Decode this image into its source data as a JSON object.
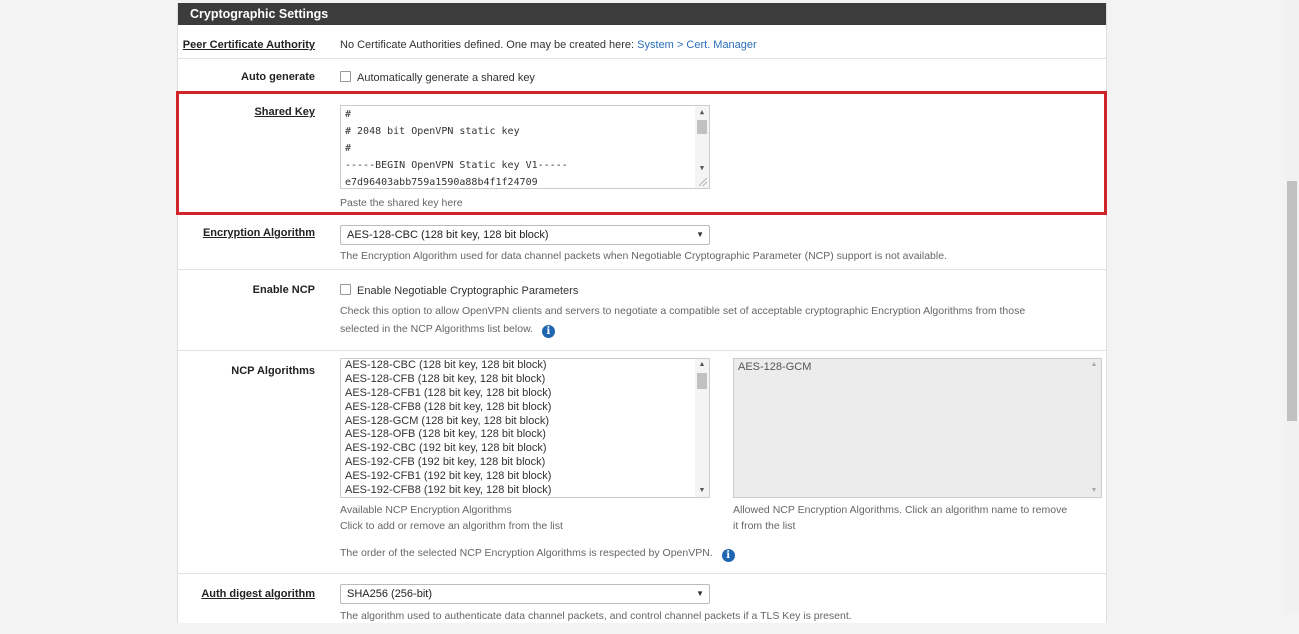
{
  "section": {
    "title": "Cryptographic Settings"
  },
  "peer_ca": {
    "label": "Peer Certificate Authority",
    "text": "No Certificate Authorities defined. One may be created here: ",
    "link": "System > Cert. Manager"
  },
  "auto_generate": {
    "label": "Auto generate",
    "checkbox_label": "Automatically generate a shared key",
    "checked": false
  },
  "shared_key": {
    "label": "Shared Key",
    "lines": [
      "#",
      "# 2048 bit OpenVPN static key",
      "#",
      "-----BEGIN OpenVPN Static key V1-----",
      "e7d96403abb759a1590a88b4f1f24709"
    ],
    "help": "Paste the shared key here"
  },
  "encryption": {
    "label": "Encryption Algorithm",
    "selected": "AES-128-CBC (128 bit key, 128 bit block)",
    "help": "The Encryption Algorithm used for data channel packets when Negotiable Cryptographic Parameter (NCP) support is not available."
  },
  "ncp": {
    "label": "Enable NCP",
    "checkbox_label": "Enable Negotiable Cryptographic Parameters",
    "checked": false,
    "help_line1": "Check this option to allow OpenVPN clients and servers to negotiate a compatible set of acceptable cryptographic Encryption Algorithms from those",
    "help_line2": "selected in the NCP Algorithms list below."
  },
  "ncp_algorithms": {
    "label": "NCP Algorithms",
    "available": [
      "AES-128-CBC (128 bit key, 128 bit block)",
      "AES-128-CFB (128 bit key, 128 bit block)",
      "AES-128-CFB1 (128 bit key, 128 bit block)",
      "AES-128-CFB8 (128 bit key, 128 bit block)",
      "AES-128-GCM (128 bit key, 128 bit block)",
      "AES-128-OFB (128 bit key, 128 bit block)",
      "AES-192-CBC (192 bit key, 128 bit block)",
      "AES-192-CFB (192 bit key, 128 bit block)",
      "AES-192-CFB1 (192 bit key, 128 bit block)",
      "AES-192-CFB8 (192 bit key, 128 bit block)"
    ],
    "allowed": [
      "AES-128-GCM"
    ],
    "available_help_1": "Available NCP Encryption Algorithms",
    "available_help_2": "Click to add or remove an algorithm from the list",
    "allowed_help_1": "Allowed NCP Encryption Algorithms. Click an algorithm name to remove",
    "allowed_help_2": "it from the list",
    "order_note": "The order of the selected NCP Encryption Algorithms is respected by OpenVPN."
  },
  "auth_digest": {
    "label": "Auth digest algorithm",
    "selected": "SHA256 (256-bit)",
    "help": "The algorithm used to authenticate data channel packets, and control channel packets if a TLS Key is present."
  },
  "colors": {
    "header_bg": "#3c3c3c",
    "highlight_border": "#d1232a",
    "link": "#2a6ebb",
    "info_icon": "#1f65b0"
  },
  "icons": {
    "info": "info-circle-icon",
    "dropdown": "chevron-down-icon"
  }
}
